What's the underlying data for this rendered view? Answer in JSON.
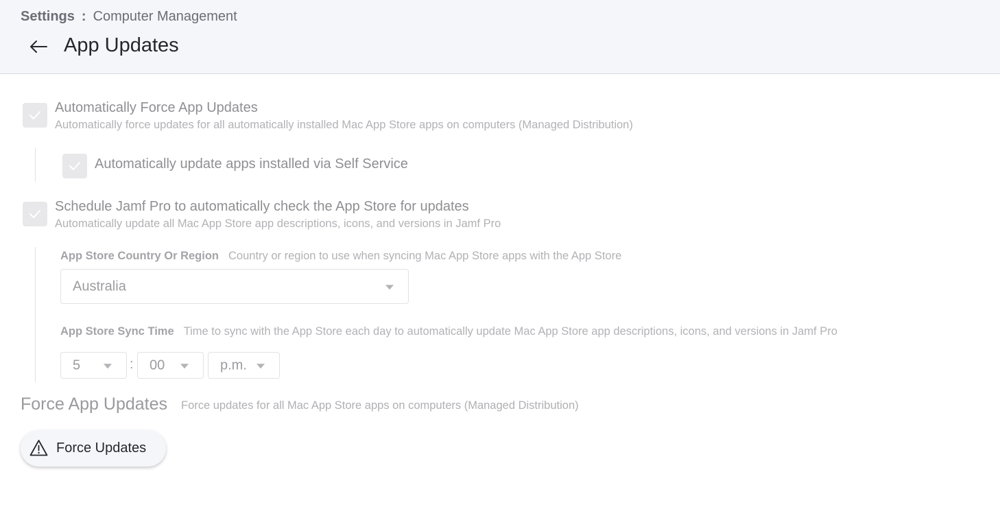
{
  "header": {
    "breadcrumb_root": "Settings",
    "breadcrumb_separator": ":",
    "breadcrumb_current": "Computer Management",
    "title": "App Updates"
  },
  "options": {
    "auto_force": {
      "title": "Automatically Force App Updates",
      "description": "Automatically force updates for all automatically installed Mac App Store apps on computers (Managed Distribution)",
      "checked": true
    },
    "self_service": {
      "title": "Automatically update apps installed via Self Service",
      "checked": true
    },
    "schedule": {
      "title": "Schedule Jamf Pro to automatically check the App Store for updates",
      "description": "Automatically update all Mac App Store app descriptions, icons, and versions in Jamf Pro",
      "checked": true
    }
  },
  "country_field": {
    "label": "App Store Country Or Region",
    "description": "Country or region to use when syncing Mac App Store apps with the App Store",
    "value": "Australia"
  },
  "sync_time_field": {
    "label": "App Store Sync Time",
    "description": "Time to sync with the App Store each day to automatically update Mac App Store app descriptions, icons, and versions in Jamf Pro",
    "hour": "5",
    "separator": ":",
    "minute": "00",
    "period": "p.m."
  },
  "force_section": {
    "title": "Force App Updates",
    "description": "Force updates for all Mac App Store apps on computers (Managed Distribution)",
    "button_label": "Force Updates"
  },
  "icons": {
    "back": "arrow-left-icon",
    "check": "check-icon",
    "caret": "caret-down-icon",
    "warning": "warning-triangle-icon"
  },
  "colors": {
    "header_bg": "#f5f6f9",
    "title_text": "#26272b",
    "disabled_text": "#a6a6a6",
    "checkbox_bg": "#e8e8ea"
  }
}
